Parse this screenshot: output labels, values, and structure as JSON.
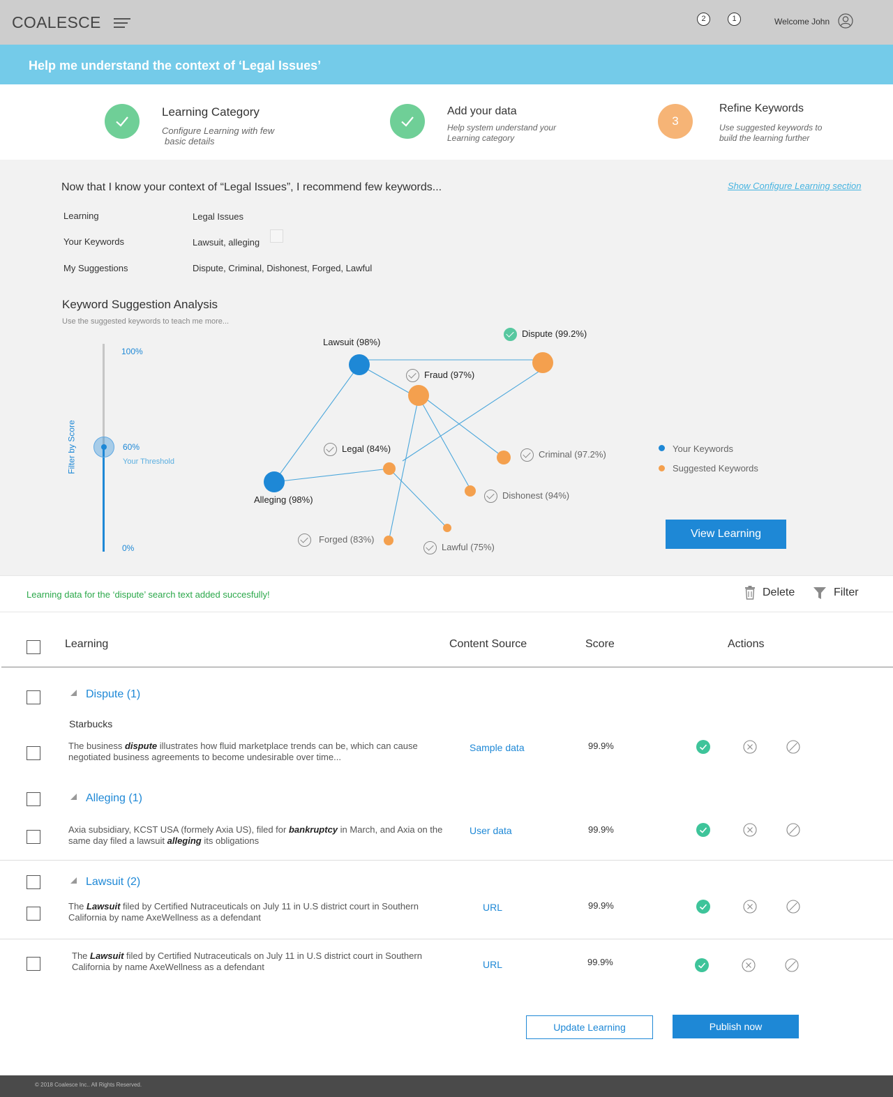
{
  "app": {
    "logo": "COALESCE",
    "welcome": "Welcome John",
    "notifications": [
      "2",
      "1"
    ]
  },
  "banner": {
    "title": "Help me understand the context of ‘Legal Issues’"
  },
  "steps": [
    {
      "title": "Learning Category",
      "desc_line1": "Configure Learning with few",
      "desc_line2": "basic details",
      "state": "done"
    },
    {
      "title": "Add your data",
      "desc_line1": "Help system understand your",
      "desc_line2": "Learning category",
      "state": "done"
    },
    {
      "title": "Refine Keywords",
      "number": "3",
      "desc_line1": "Use suggested keywords to",
      "desc_line2": "build the learning further",
      "state": "active"
    }
  ],
  "context": {
    "intro": "Now that I know your context of “Legal Issues”, I recommend few keywords...",
    "show_link": "Show Configure Learning section",
    "rows": [
      {
        "label": "Learning",
        "value": "Legal Issues"
      },
      {
        "label": "Your Keywords",
        "value": "Lawsuit, alleging"
      },
      {
        "label": "My Suggestions",
        "value": "Dispute, Criminal, Dishonest, Forged, Lawful"
      }
    ]
  },
  "analysis": {
    "title": "Keyword Suggestion Analysis",
    "subtitle": "Use the suggested keywords to teach me more...",
    "filter_label": "Filter by Score",
    "slider": {
      "max_label": "100%",
      "min_label": "0%",
      "value_label": "60%",
      "threshold_label": "Your Threshold",
      "value": 60
    },
    "nodes": {
      "lawsuit": "Lawsuit (98%)",
      "alleging": "Alleging (98%)",
      "dispute": "Dispute (99.2%)",
      "fraud": "Fraud (97%)",
      "legal": "Legal (84%)",
      "criminal": "Criminal (97.2%)",
      "dishonest": "Dishonest (94%)",
      "forged": "Forged (83%)",
      "lawful": "Lawful (75%)"
    },
    "legend": {
      "your": "Your Keywords",
      "suggested": "Suggested Keywords"
    },
    "colors": {
      "your": "#1e88d6",
      "suggested": "#f4a04e",
      "edge": "#4aa6db"
    },
    "view_button": "View Learning"
  },
  "status": {
    "message": "Learning data for the ‘dispute’ search text added succesfully!",
    "delete": "Delete",
    "filter": "Filter"
  },
  "table": {
    "headers": {
      "learning": "Learning",
      "source": "Content Source",
      "score": "Score",
      "actions": "Actions"
    },
    "groups": {
      "dispute": "Dispute (1)",
      "alleging": "Alleging (1)",
      "lawsuit": "Lawsuit (2)"
    },
    "company": "Starbucks",
    "rows": [
      {
        "pre": "The business ",
        "em": "dispute",
        "post": " illustrates how fluid marketplace trends can be, which can cause negotiated business agreements to become undesirable over time...",
        "source": "Sample data",
        "score": "99.9%"
      },
      {
        "pre": "Axia subsidiary, KCST USA (formely Axia US), filed for ",
        "em": "bankruptcy",
        "mid": " in March, and Axia on the same day filed a lawsuit ",
        "em2": "alleging",
        "post": " its obligations",
        "source": "User data",
        "score": "99.9%"
      },
      {
        "pre": "The ",
        "em": "Lawsuit",
        "post": " filed by Certified Nutraceuticals on July 11 in U.S district court in Southern California by name AxeWellness as a defendant",
        "source": "URL",
        "score": "99.9%"
      },
      {
        "pre": "The ",
        "em": "Lawsuit",
        "post": " filed by Certified Nutraceuticals on July 11 in U.S district court in Southern California by name AxeWellness as a defendant",
        "source": "URL",
        "score": "99.9%"
      }
    ]
  },
  "buttons": {
    "update": "Update Learning",
    "publish": "Publish now"
  },
  "footer": {
    "copyright": "© 2018 Coalesce Inc.. All Rights Reserved."
  }
}
